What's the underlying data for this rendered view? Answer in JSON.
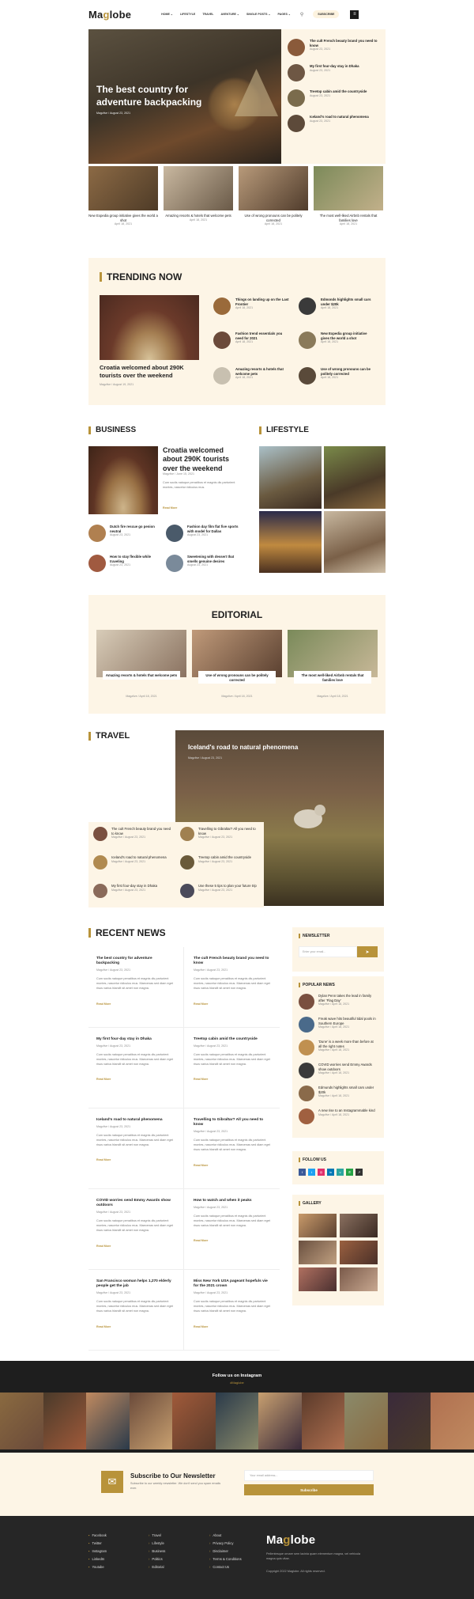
{
  "header": {
    "logo_left": "Ma",
    "logo_pin": "g",
    "logo_right": "lobe",
    "nav": [
      "HOME ⌄",
      "LIFESTYLE",
      "TRAVEL",
      "AVENTURE ⌄",
      "SINGLE POSTS ⌄",
      "PAGES ⌄"
    ],
    "subscribe": "SUBSCRIBE"
  },
  "hero": {
    "title": "The best country for adventure backpacking",
    "meta": "Magzlive / August 23, 2021",
    "side": [
      {
        "title": "The cult French beauty brand you need to know",
        "meta": "August 23, 2021"
      },
      {
        "title": "My first four-day stay in Dhaka",
        "meta": "August 23, 2021"
      },
      {
        "title": "Treetop cabin amid the countryside",
        "meta": "August 23, 2021"
      },
      {
        "title": "Iceland's road to natural phenomena",
        "meta": "August 23, 2021"
      }
    ],
    "row": [
      {
        "title": "New Expedia group initiative gives the world a shot",
        "meta": "April 18, 2021"
      },
      {
        "title": "Amazing resorts & hotels that welcome pets",
        "meta": "April 18, 2021"
      },
      {
        "title": "Use of wrong pronouns can be politely corrected",
        "meta": "April 18, 2021"
      },
      {
        "title": "The most well-liked Airbnb rentals that families love",
        "meta": "April 18, 2021"
      }
    ]
  },
  "trending": {
    "title": "TRENDING NOW",
    "main_title": "Croatia welcomed about 290K tourists over the weekend",
    "main_meta": "Magzlive / August 19, 2021",
    "items": [
      {
        "title": "Things on landing up on the Last Frontier",
        "meta": "April 18, 2021"
      },
      {
        "title": "Edmonds highlights small cars under $20k",
        "meta": "April 18, 2021"
      },
      {
        "title": "Fashion trend essentials you need for 2021",
        "meta": "April 18, 2021"
      },
      {
        "title": "New Expedia group initiative gives the world a shot",
        "meta": "April 18, 2021"
      },
      {
        "title": "Amazing resorts & hotels that welcome pets",
        "meta": "April 18, 2021"
      },
      {
        "title": "Use of wrong pronouns can be politely corrected",
        "meta": "April 18, 2021"
      }
    ]
  },
  "business": {
    "title": "BUSINESS",
    "main_title": "Croatia welcomed about 290K tourists over the weekend",
    "main_meta": "Magzlive / June 15, 2021",
    "main_excerpt": "Cum sociis natoque penatibus et magnis dis parturient montes, nascetur ridiculus mus.",
    "read": "Read More",
    "items": [
      {
        "title": "Dutch fire rescue go penion neutral",
        "meta": "August 23, 2021"
      },
      {
        "title": "Fashion day film flat five sports with model for Dallas",
        "meta": "August 23, 2021"
      },
      {
        "title": "How to stay flexible while traveling",
        "meta": "August 23, 2021"
      },
      {
        "title": "Sweetening with dessert that smells genuine desires",
        "meta": "August 23, 2021"
      }
    ]
  },
  "lifestyle": {
    "title": "LIFESTYLE"
  },
  "editorial": {
    "title": "EDITORIAL",
    "items": [
      {
        "title": "Amazing resorts & hotels that welcome pets",
        "meta": "Magzlive / April 18, 2021"
      },
      {
        "title": "Use of wrong pronouns can be politely corrected",
        "meta": "Magzlive / April 18, 2021"
      },
      {
        "title": "The most well-liked Airbnb rentals that families love",
        "meta": "Magzlive / April 18, 2021"
      }
    ]
  },
  "travel": {
    "title": "TRAVEL",
    "main_title": "Iceland's road to natural phenomena",
    "main_meta": "Magzlive / August 23, 2021",
    "items": [
      {
        "title": "The cult French beauty brand you need to know",
        "meta": "Magzlive / August 23, 2021"
      },
      {
        "title": "Travelling to Gibraltar? All you need to know",
        "meta": "Magzlive / August 23, 2021"
      },
      {
        "title": "Iceland's road to natural phenomena",
        "meta": "Magzlive / August 23, 2021"
      },
      {
        "title": "Treetop cabin amid the countryside",
        "meta": "Magzlive / August 23, 2021"
      },
      {
        "title": "My first four-day stay in Dhaka",
        "meta": "Magzlive / August 23, 2021"
      },
      {
        "title": "Use these 5 tips to plan your future trip",
        "meta": "Magzlive / August 23, 2021"
      }
    ]
  },
  "recent": {
    "title": "RECENT NEWS",
    "excerpt": "Cum sociis natoque penatibus et magnis dis parturient montes, nascetur ridiculus mus. Maecenas sed diam eget risus varius blandit sit amet non magna.",
    "read": "Read More",
    "items": [
      {
        "title": "The best country for adventure backpacking",
        "meta": "Magzlive / August 23, 2021"
      },
      {
        "title": "The cult French beauty brand you need to know",
        "meta": "Magzlive / August 23, 2021"
      },
      {
        "title": "My first four-day stay in Dhaka",
        "meta": "Magzlive / August 23, 2021"
      },
      {
        "title": "Treetop cabin amid the countryside",
        "meta": "Magzlive / August 23, 2021"
      },
      {
        "title": "Iceland's road to natural phenomena",
        "meta": "Magzlive / August 23, 2021"
      },
      {
        "title": "Travelling to Gibraltar? All you need to know",
        "meta": "Magzlive / August 23, 2021"
      },
      {
        "title": "COVID worries send Emmy Awards show outdoors",
        "meta": "Magzlive / August 23, 2021"
      },
      {
        "title": "How to watch and when it peaks",
        "meta": "Magzlive / August 23, 2021"
      },
      {
        "title": "San Francisco woman helps 1,270 elderly people get the jab",
        "meta": "Magzlive / August 23, 2021"
      },
      {
        "title": "Miss New York USA pageant hopefuls vie for the 2021 crown",
        "meta": "Magzlive / August 23, 2021"
      }
    ]
  },
  "sidebar": {
    "newsletter_title": "NEWSLETTER",
    "email_placeholder": "Enter your email...",
    "popular_title": "POPULAR NEWS",
    "popular": [
      {
        "title": "Dylan Penn takes the lead in family after 'Flag Day'",
        "meta": "Magzlive / April 18, 2021"
      },
      {
        "title": "Freak wave hits beautiful tidal pools in Southern Europe",
        "meta": "Magzlive / April 18, 2021"
      },
      {
        "title": "'Dune' is a week more than before at all the right notes",
        "meta": "Magzlive / April 18, 2021"
      },
      {
        "title": "COVID worries send Emmy Awards show outdoors",
        "meta": "Magzlive / April 18, 2021"
      },
      {
        "title": "Edmunds highlights small cars under $20k",
        "meta": "Magzlive / April 18, 2021"
      },
      {
        "title": "A new rise to an Instagrammable kind",
        "meta": "Magzlive / April 18, 2021"
      }
    ],
    "follow_title": "FOLLOW US",
    "social_colors": [
      "#3b5998",
      "#1da1f2",
      "#e1306c",
      "#0077b5",
      "#2ba5a0",
      "#25a244",
      "#333333"
    ],
    "gallery_title": "GALLERY"
  },
  "instagram": {
    "title": "Follow us on Instagram",
    "handle": "#Maglobe"
  },
  "subscribe": {
    "title": "Subscribe to Our Newsletter",
    "text": "Subscribe to our weekly newsletter. We don't send you spam emails ever.",
    "placeholder": "Your email address...",
    "button": "Subscribe"
  },
  "footer": {
    "col1": [
      "Facebook",
      "Twitter",
      "Instagram",
      "LinkedIn",
      "Youtube"
    ],
    "col2": [
      "Travel",
      "Lifestyle",
      "Business",
      "Politics",
      "Editorial"
    ],
    "col3": [
      "About",
      "Privacy Policy",
      "Disclaimer",
      "Terms & Conditions",
      "Contact Us"
    ],
    "about": "Pellentesque ornare sem lacinia quam elementum magna, vel vehicula magna quis vitae.",
    "copyright": "Copyright 2022 Maglobe. All rights reserved."
  }
}
